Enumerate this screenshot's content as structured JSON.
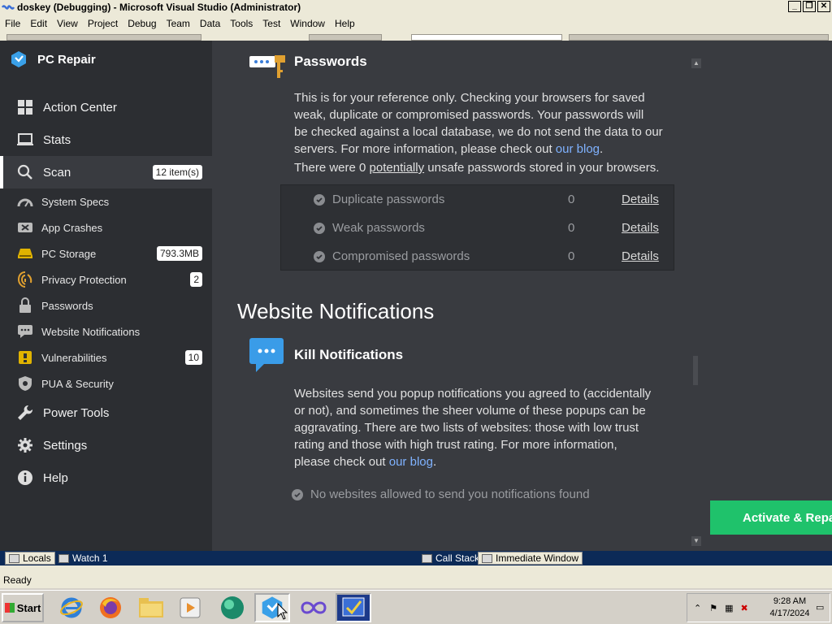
{
  "window": {
    "title": "doskey (Debugging) - Microsoft Visual Studio (Administrator)",
    "menu": [
      "File",
      "Edit",
      "View",
      "Project",
      "Debug",
      "Team",
      "Data",
      "Tools",
      "Test",
      "Window",
      "Help"
    ]
  },
  "sidebar": {
    "brand": "PC Repair",
    "items": [
      {
        "label": "Action Center",
        "icon": "grid-icon"
      },
      {
        "label": "Stats",
        "icon": "laptop-icon"
      },
      {
        "label": "Scan",
        "icon": "search-icon",
        "badge": "12 item(s)",
        "active": true
      },
      {
        "label": "System Specs",
        "icon": "gauge-icon"
      },
      {
        "label": "App Crashes",
        "icon": "crash-icon"
      },
      {
        "label": "PC Storage",
        "icon": "drive-icon",
        "badge": "793.3MB"
      },
      {
        "label": "Privacy Protection",
        "icon": "privacy-icon",
        "badge": "2"
      },
      {
        "label": "Passwords",
        "icon": "lock-icon"
      },
      {
        "label": "Website Notifications",
        "icon": "chat-icon"
      },
      {
        "label": "Vulnerabilities",
        "icon": "vuln-icon",
        "badge": "10"
      },
      {
        "label": "PUA & Security",
        "icon": "shield-icon"
      },
      {
        "label": "Power Tools",
        "icon": "wrench-icon"
      },
      {
        "label": "Settings",
        "icon": "gear-icon"
      },
      {
        "label": "Help",
        "icon": "info-icon"
      }
    ]
  },
  "passwords": {
    "title": "Passwords",
    "desc_1": "This is for your reference only. Checking your browsers for saved",
    "desc_2": "weak, duplicate or compromised passwords. Your passwords will",
    "desc_3": "be checked against a local database, we do not send the data to our",
    "desc_4": "servers. For more information, please check out ",
    "desc_link": "our blog",
    "desc_end": ".",
    "summary_pre": "There were 0 ",
    "summary_link": "potentially",
    "summary_post": " unsafe passwords stored in your browsers.",
    "rows": [
      {
        "label": "Duplicate passwords",
        "count": "0",
        "action": "Details"
      },
      {
        "label": "Weak passwords",
        "count": "0",
        "action": "Details"
      },
      {
        "label": "Compromised passwords",
        "count": "0",
        "action": "Details"
      }
    ]
  },
  "notifications": {
    "section_title": "Website Notifications",
    "title": "Kill Notifications",
    "desc_1": "Websites send you popup notifications you agreed to (accidentally",
    "desc_2": "or not), and sometimes the sheer volume of these popups can be",
    "desc_3": "aggravating. There are two lists of websites: those with low trust",
    "desc_4": "rating and those with high trust rating. For more information,",
    "desc_5": "please check out ",
    "desc_link": "our blog",
    "desc_end": ".",
    "note": "No websites allowed to send you notifications found"
  },
  "activate_button": "Activate & Repair",
  "debug_tabs": {
    "locals": "Locals",
    "watch": "Watch 1",
    "callstack": "Call Stack",
    "immediate": "Immediate Window"
  },
  "status": "Ready",
  "taskbar": {
    "start": "Start",
    "time": "9:28 AM",
    "date": "4/17/2024"
  },
  "colors": {
    "accent_green": "#1fc26b",
    "link_blue": "#7fb2ff",
    "sidebar_bg": "#2c2e32",
    "content_bg": "#393b40"
  }
}
